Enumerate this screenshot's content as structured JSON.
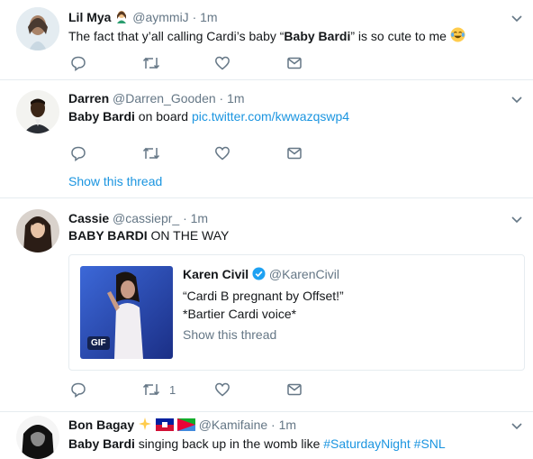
{
  "colors": {
    "link": "#1b95e0",
    "secondary": "#657786",
    "divider": "#e6ecf0",
    "verified": "#1da1f2"
  },
  "tweets": [
    {
      "name": "Lil Mya",
      "handle": "@aymmiJ",
      "dot": "·",
      "time": "1m",
      "name_emoji": "woman-emoji-icon",
      "text_pre": "The fact that y’all calling Cardi’s baby “",
      "text_bold": "Baby Bardi",
      "text_post": "” is so cute to me",
      "text_emoji": "tears-of-joy-emoji-icon"
    },
    {
      "name": "Darren",
      "handle": "@Darren_Gooden",
      "dot": "·",
      "time": "1m",
      "text_bold": "Baby Bardi",
      "text_post": " on board ",
      "text_link": "pic.twitter.com/kwwazqswp4",
      "show_thread": "Show this thread"
    },
    {
      "name": "Cassie",
      "handle": "@cassiepr_",
      "dot": "·",
      "time": "1m",
      "text_bold": "BABY BARDI",
      "text_post": " ON THE WAY",
      "retweet_count": "1",
      "quote": {
        "name": "Karen Civil",
        "handle": "@KarenCivil",
        "line1": "“Cardi B pregnant by Offset!”",
        "line2": "*Bartier Cardi voice*",
        "show_thread": "Show this thread",
        "gif_badge": "GIF"
      }
    },
    {
      "name": "Bon Bagay",
      "handle": "@Kamifaine",
      "dot": "·",
      "time": "1m",
      "name_emojis": [
        "sparkles-emoji-icon",
        "haiti-flag-icon",
        "eritrea-flag-icon"
      ],
      "text_bold": "Baby Bardi",
      "text_post": " singing back up in the womb like ",
      "hashtag1": "#SaturdayNight",
      "hashtag2": "#SNL"
    }
  ]
}
